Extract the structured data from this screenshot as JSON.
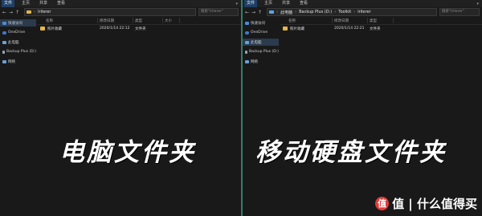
{
  "left_window": {
    "ribbon": {
      "tabs": [
        "文件",
        "主页",
        "共享",
        "查看"
      ]
    },
    "nav_icons": [
      "back-arrow-icon",
      "forward-arrow-icon",
      "up-arrow-icon"
    ],
    "address": {
      "segments": [
        "lrilerer"
      ]
    },
    "search_placeholder": "搜索\"lrilerer\"",
    "sidebar": [
      {
        "label": "快速访问",
        "icon": "star-icon",
        "active": true
      },
      {
        "label": "OneDrive",
        "icon": "cloud-icon",
        "active": false
      },
      {
        "label": "此电脑",
        "icon": "computer-icon",
        "active": false
      },
      {
        "label": "Backup Plus (D:)",
        "icon": "drive-icon",
        "active": false
      },
      {
        "label": "网络",
        "icon": "network-icon",
        "active": false
      }
    ],
    "columns": [
      "名称",
      "修改日期",
      "类型",
      "大小"
    ],
    "rows": [
      {
        "name": "照片收藏",
        "modified": "2020/1/14 22:12",
        "type": "文件夹",
        "size": ""
      }
    ],
    "caption": "电脑文件夹"
  },
  "right_window": {
    "ribbon": {
      "tabs": [
        "文件",
        "主页",
        "共享",
        "查看"
      ]
    },
    "nav_icons": [
      "back-arrow-icon",
      "forward-arrow-icon",
      "up-arrow-icon"
    ],
    "address": {
      "segments": [
        "此电脑",
        "Backup Plus (D:)",
        "Toolkit",
        "lrilerer"
      ]
    },
    "search_placeholder": "搜索\"lrilerer\"",
    "sidebar": [
      {
        "label": "快速访问",
        "icon": "star-icon",
        "active": false
      },
      {
        "label": "OneDrive",
        "icon": "cloud-icon",
        "active": false
      },
      {
        "label": "此电脑",
        "icon": "computer-icon",
        "active": true
      },
      {
        "label": "Backup Plus (D:)",
        "icon": "drive-icon",
        "active": false
      },
      {
        "label": "网络",
        "icon": "network-icon",
        "active": false
      }
    ],
    "columns": [
      "名称",
      "修改日期",
      "类型"
    ],
    "rows": [
      {
        "name": "照片收藏",
        "modified": "2020/1/14 22:21",
        "type": "文件夹"
      }
    ],
    "caption": "移动硬盘文件夹"
  },
  "watermark": {
    "text": "值 | 什么值得买",
    "logo": "值"
  },
  "colors": {
    "background": "#191919",
    "splitter": "#2e7f6a",
    "active_tab": "#1f3f66",
    "folder": "#e2b64c",
    "watermark_logo": "#e33a3a"
  }
}
